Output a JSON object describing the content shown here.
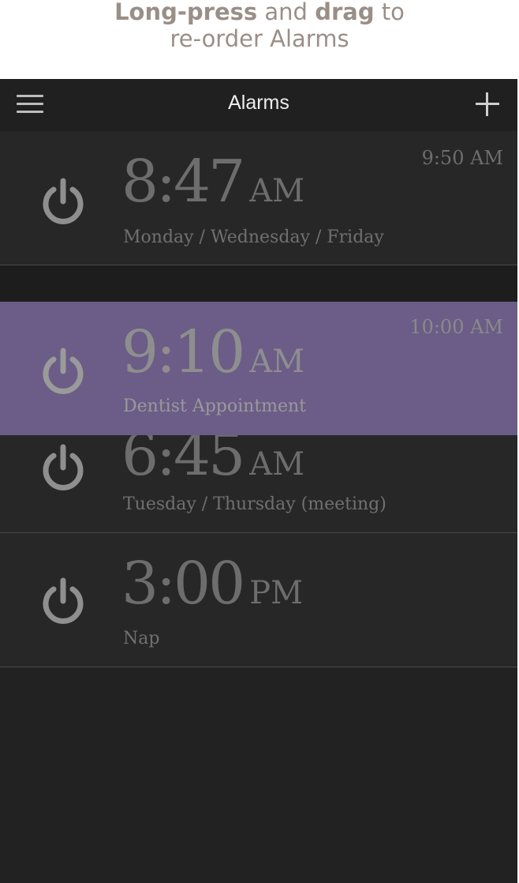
{
  "caption": {
    "line1_bold1": "Long-press",
    "line1_mid": " and ",
    "line1_bold2": "drag",
    "line1_end": " to",
    "line2": "re-order Alarms"
  },
  "header": {
    "title": "Alarms",
    "menu_icon": "hamburger-menu-icon",
    "add_icon": "plus-icon"
  },
  "alarms": [
    {
      "time": "8:47",
      "ampm": "AM",
      "label": "Monday / Wednesday / Friday",
      "next": "9:50 AM"
    },
    {
      "time": "9:10",
      "ampm": "AM",
      "label": "Dentist Appointment",
      "next": "10:00 AM",
      "dragging": true
    },
    {
      "time": "6:45",
      "ampm": "AM",
      "label": "Tuesday / Thursday (meeting)"
    },
    {
      "time": "3:00",
      "ampm": "PM",
      "label": "Nap"
    }
  ],
  "colors": {
    "background": "#222222",
    "drag_highlight": "#6b5d87",
    "caption": "#9a8f88"
  }
}
